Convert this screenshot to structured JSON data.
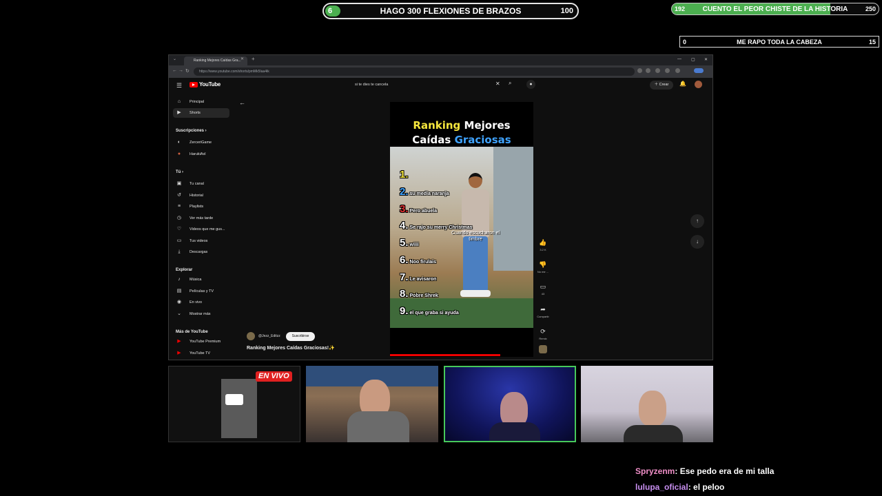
{
  "goals": {
    "top_center": {
      "current": "6",
      "title": "HAGO 300 FLEXIONES DE BRAZOS",
      "max": "100",
      "progress": 0.06
    },
    "top_right": {
      "current": "192",
      "title": "CUENTO EL PEOR CHISTE DE LA HISTORIA",
      "max": "250",
      "progress": 0.768
    },
    "second_right": {
      "current": "0",
      "title": "ME RAPO TODA LA CABEZA",
      "max": "15",
      "progress": 0
    }
  },
  "browser": {
    "tab_title": "Ranking Mejores Caídas Gra...",
    "url": "https://www.youtube.com/shorts/pmMk5Iaa4ik",
    "youtube_label": "YouTube",
    "search_query": "si te dies te cancela",
    "create_label": "Crear",
    "sidebar": {
      "main": [
        {
          "icon": "home-icon",
          "label": "Principal"
        },
        {
          "icon": "shorts-icon",
          "label": "Shorts"
        }
      ],
      "subs_heading": "Suscripciones ›",
      "subs": [
        {
          "label": "ZerceriGame"
        },
        {
          "label": "HarukiAxl"
        }
      ],
      "you_heading": "Tú ›",
      "you": [
        {
          "icon": "channel-icon",
          "label": "Tu canal"
        },
        {
          "icon": "history-icon",
          "label": "Historial"
        },
        {
          "icon": "playlists-icon",
          "label": "Playlists"
        },
        {
          "icon": "watch-later-icon",
          "label": "Ver más tarde"
        },
        {
          "icon": "liked-icon",
          "label": "Videos que me gus..."
        },
        {
          "icon": "your-videos-icon",
          "label": "Tus videos"
        },
        {
          "icon": "downloads-icon",
          "label": "Descargas"
        }
      ],
      "explore_heading": "Explorar",
      "explore": [
        {
          "icon": "music-icon",
          "label": "Música"
        },
        {
          "icon": "movies-icon",
          "label": "Películas y TV"
        },
        {
          "icon": "live-icon",
          "label": "En vivo"
        },
        {
          "icon": "chevron-down-icon",
          "label": "Mostrar más"
        }
      ],
      "more_heading": "Más de YouTube",
      "more": [
        {
          "icon": "youtube-premium-icon",
          "label": "YouTube Premium"
        },
        {
          "icon": "youtube-tv-icon",
          "label": "YouTube TV"
        }
      ]
    },
    "short": {
      "title_line1_a": "Ranking",
      "title_line1_b": "Mejores",
      "title_line2_a": "Caídas",
      "title_line2_b": "Graciosas",
      "ranking": [
        {
          "n": "1.",
          "text": ""
        },
        {
          "n": "2.",
          "text": "su media naranja"
        },
        {
          "n": "3.",
          "text": "Pero abuela"
        },
        {
          "n": "4.",
          "text": "Se rajo su merry Christmas"
        },
        {
          "n": "5.",
          "text": "wiiii"
        },
        {
          "n": "6.",
          "text": "Noo firulais"
        },
        {
          "n": "7.",
          "text": "Le avisaron"
        },
        {
          "n": "8.",
          "text": "Pobre Shrek"
        },
        {
          "n": "9.",
          "text": "el que graba si ayuda"
        }
      ],
      "caption_overlay": "Cuando escucharon el timbre",
      "likes": "3.2 K",
      "dislike_label": "No me ...",
      "comments": "43",
      "share_label": "Compartir",
      "remix_label": "Remix",
      "channel": "@Jezz_Editzz",
      "subscribe_label": "Suscribirse",
      "video_title": "Ranking Mejores Caídas Graciosas!✨"
    }
  },
  "cams": {
    "live_badge": "EN VIVO"
  },
  "chat": [
    {
      "user": "Spryzenm",
      "message": ": Ese pedo era de mi talla"
    },
    {
      "user": "lulupa_oficial",
      "message": ": el peloo"
    }
  ],
  "colors": {
    "goal_fill": "#4caf50",
    "youtube_red": "#ff0000",
    "title_yellow": "#f5e63d",
    "title_blue": "#3fa3ff",
    "cam_highlight": "#47c95a",
    "live_red": "#e02020"
  }
}
